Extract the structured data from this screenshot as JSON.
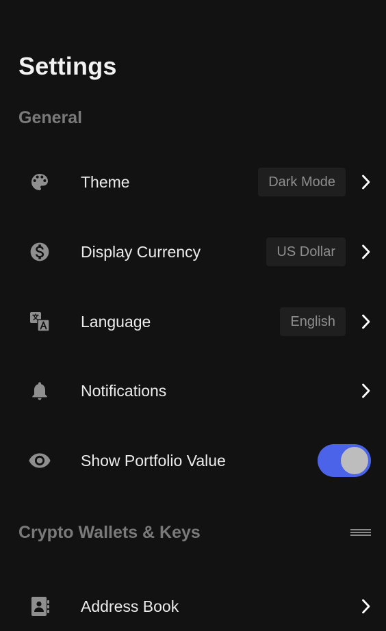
{
  "page": {
    "title": "Settings"
  },
  "sections": {
    "general": {
      "title": "General"
    },
    "crypto": {
      "title": "Crypto Wallets & Keys"
    }
  },
  "rows": {
    "theme": {
      "label": "Theme",
      "value": "Dark Mode",
      "icon": "palette-icon"
    },
    "currency": {
      "label": "Display Currency",
      "value": "US Dollar",
      "icon": "dollar-icon"
    },
    "language": {
      "label": "Language",
      "value": "English",
      "icon": "translate-icon"
    },
    "notifications": {
      "label": "Notifications",
      "icon": "bell-icon"
    },
    "portfolio": {
      "label": "Show Portfolio Value",
      "icon": "eye-icon",
      "enabled": true
    },
    "address_book": {
      "label": "Address Book",
      "icon": "contact-book-icon"
    }
  },
  "colors": {
    "background": "#121212",
    "accent": "#4a63e8",
    "section_title": "#7a7a7a",
    "value_chip": "#1f1f1f"
  }
}
